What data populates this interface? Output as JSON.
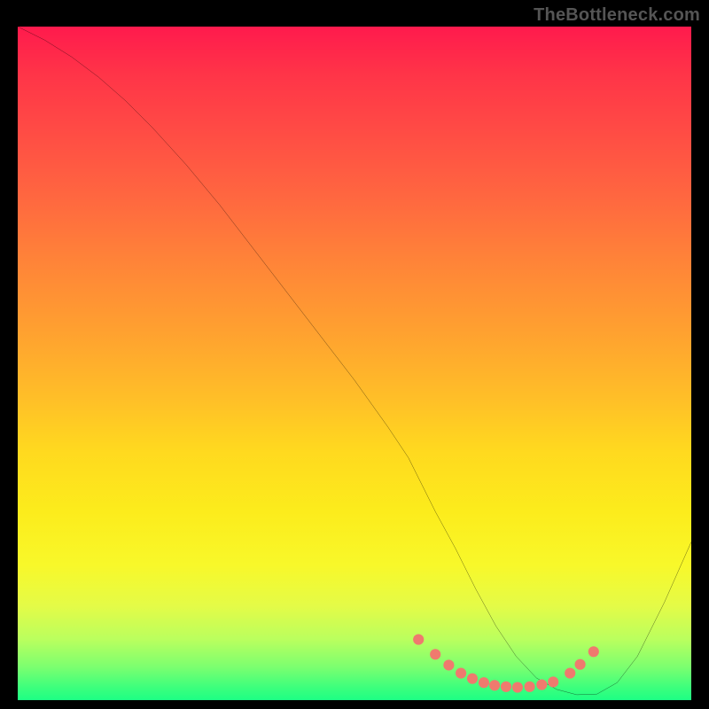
{
  "watermark": "TheBottleneck.com",
  "chart_data": {
    "type": "line",
    "title": "",
    "xlabel": "",
    "ylabel": "",
    "xlim": [
      0,
      100
    ],
    "ylim": [
      0,
      100
    ],
    "grid": false,
    "series": [
      {
        "name": "curve",
        "color": "#000000",
        "x": [
          0,
          4,
          8,
          12,
          16,
          20,
          25,
          30,
          35,
          40,
          45,
          50,
          55,
          58,
          60,
          62,
          65,
          68,
          71,
          74,
          77,
          80,
          83,
          86,
          89,
          92,
          96,
          100
        ],
        "y": [
          100,
          98,
          95.5,
          92.5,
          89,
          85,
          79.5,
          73.5,
          67,
          60.5,
          54,
          47.5,
          40.5,
          36,
          32,
          28,
          22.5,
          16.5,
          11,
          6.5,
          3.3,
          1.6,
          0.8,
          0.9,
          2.6,
          6.5,
          14.5,
          23.5
        ]
      }
    ],
    "dots": {
      "color": "#ef7a6e",
      "radius_pct": 0.8,
      "points": [
        {
          "x": 59.5,
          "y": 9.0
        },
        {
          "x": 62.0,
          "y": 6.8
        },
        {
          "x": 64.0,
          "y": 5.2
        },
        {
          "x": 65.8,
          "y": 4.0
        },
        {
          "x": 67.5,
          "y": 3.2
        },
        {
          "x": 69.2,
          "y": 2.6
        },
        {
          "x": 70.8,
          "y": 2.2
        },
        {
          "x": 72.5,
          "y": 2.0
        },
        {
          "x": 74.2,
          "y": 1.9
        },
        {
          "x": 76.0,
          "y": 2.0
        },
        {
          "x": 77.8,
          "y": 2.3
        },
        {
          "x": 79.5,
          "y": 2.7
        },
        {
          "x": 82.0,
          "y": 4.0
        },
        {
          "x": 83.5,
          "y": 5.3
        },
        {
          "x": 85.5,
          "y": 7.2
        }
      ]
    }
  }
}
